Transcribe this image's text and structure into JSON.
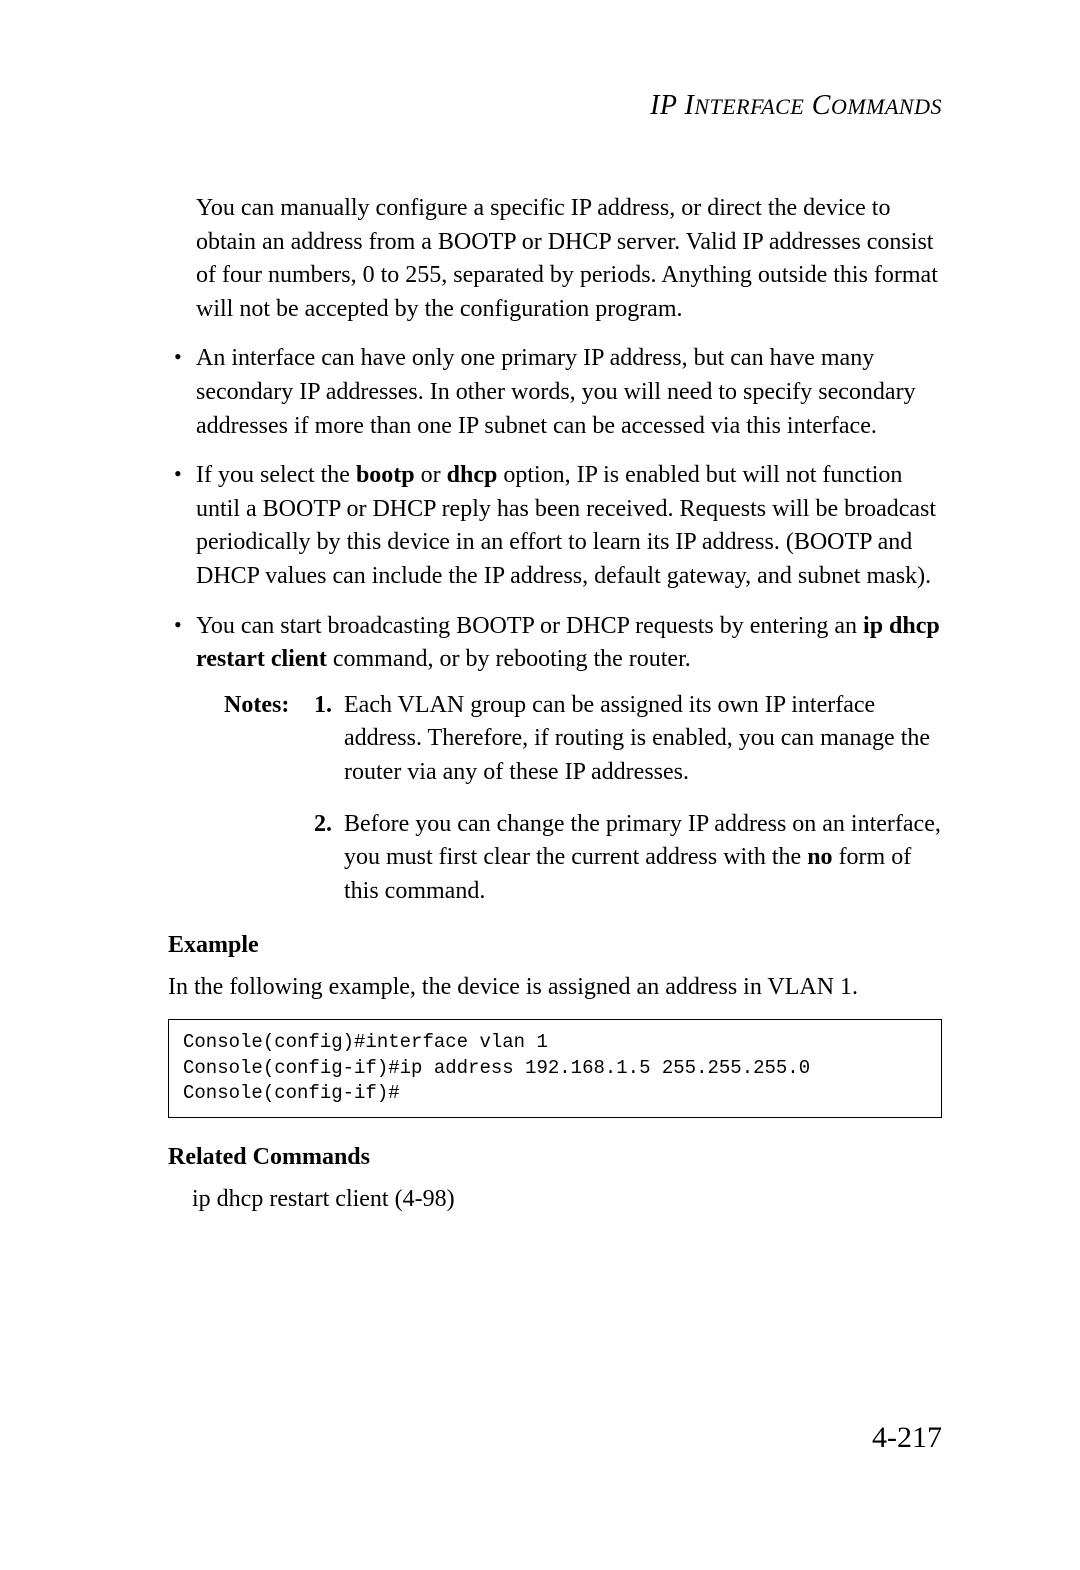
{
  "header": {
    "text": "IP INTERFACE COMMANDS"
  },
  "intro": "You can manually configure a specific IP address, or direct the device to obtain an address from a BOOTP or DHCP server. Valid IP addresses consist of four numbers, 0 to 255, separated by periods. Anything outside this format will not be accepted by the configuration program.",
  "bullets": {
    "b1": "An interface can have only one primary IP address, but can have many secondary IP addresses. In other words, you will need to specify secondary addresses if more than one IP subnet can be accessed via this interface.",
    "b2_pre": "If you select the ",
    "b2_bold1": "bootp",
    "b2_mid1": " or ",
    "b2_bold2": "dhcp",
    "b2_post": " option, IP is enabled but will not function until a BOOTP or DHCP reply has been received. Requests will be broadcast periodically by this device in an effort to learn its IP address. (BOOTP and DHCP values can include the IP address, default gateway, and subnet mask).",
    "b3_pre": "You can start broadcasting BOOTP or DHCP requests by entering an ",
    "b3_bold": "ip dhcp restart client",
    "b3_post": " command, or by rebooting the router."
  },
  "notes": {
    "label": "Notes:",
    "n1_num": "1.",
    "n1_text": "Each VLAN group can be assigned its own IP interface address. Therefore, if routing is enabled, you can manage the router via any of these IP addresses.",
    "n2_num": "2.",
    "n2_pre": "Before you can change the primary IP address on an interface, you must first clear the current address with the ",
    "n2_bold": "no",
    "n2_post": " form of this command."
  },
  "example": {
    "heading": "Example",
    "intro": "In the following example, the device is assigned an address in VLAN 1.",
    "code": "Console(config)#interface vlan 1\nConsole(config-if)#ip address 192.168.1.5 255.255.255.0\nConsole(config-if)#"
  },
  "related": {
    "heading": "Related Commands",
    "item": "ip dhcp restart client (4-98)"
  },
  "page_number": "4-217"
}
